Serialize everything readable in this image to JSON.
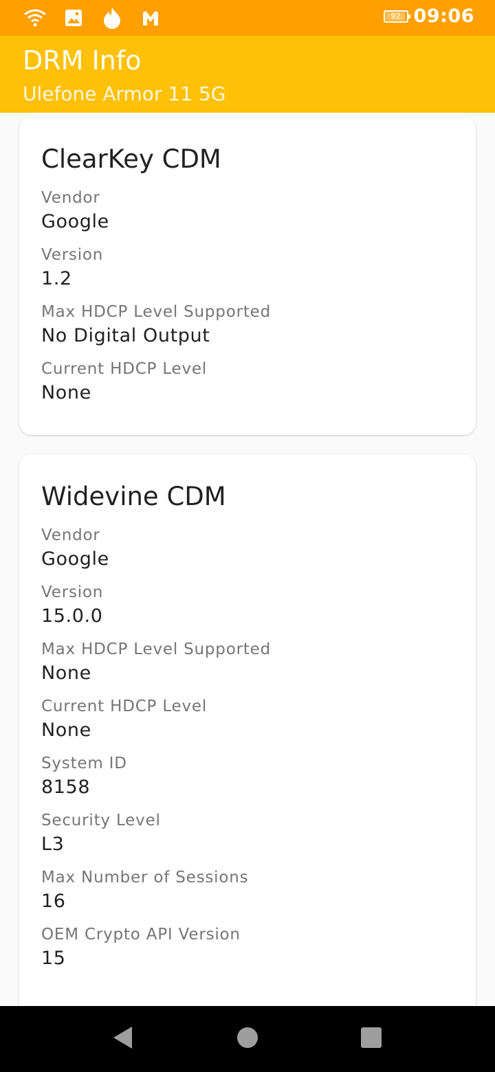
{
  "status_bar": {
    "icons": [
      "wifi-icon",
      "image-icon",
      "flame-icon",
      "malwarebytes-icon"
    ],
    "battery_level": "92",
    "time": "09:06"
  },
  "app_bar": {
    "title": "DRM Info",
    "subtitle": "Ulefone Armor 11 5G"
  },
  "cards": [
    {
      "title": "ClearKey CDM",
      "fields": [
        {
          "label": "Vendor",
          "value": "Google"
        },
        {
          "label": "Version",
          "value": "1.2"
        },
        {
          "label": "Max HDCP Level Supported",
          "value": "No Digital Output"
        },
        {
          "label": "Current HDCP Level",
          "value": "None"
        }
      ]
    },
    {
      "title": "Widevine CDM",
      "fields": [
        {
          "label": "Vendor",
          "value": "Google"
        },
        {
          "label": "Version",
          "value": "15.0.0"
        },
        {
          "label": "Max HDCP Level Supported",
          "value": "None"
        },
        {
          "label": "Current HDCP Level",
          "value": "None"
        },
        {
          "label": "System ID",
          "value": "8158"
        },
        {
          "label": "Security Level",
          "value": "L3"
        },
        {
          "label": "Max Number of Sessions",
          "value": "16"
        },
        {
          "label": "OEM Crypto API Version",
          "value": "15"
        }
      ]
    }
  ],
  "nav_bar": {
    "buttons": [
      "back-icon",
      "home-icon",
      "recents-icon"
    ]
  },
  "colors": {
    "status_bar": "#ffa000",
    "app_bar": "#ffc107",
    "nav_bar": "#000000"
  }
}
